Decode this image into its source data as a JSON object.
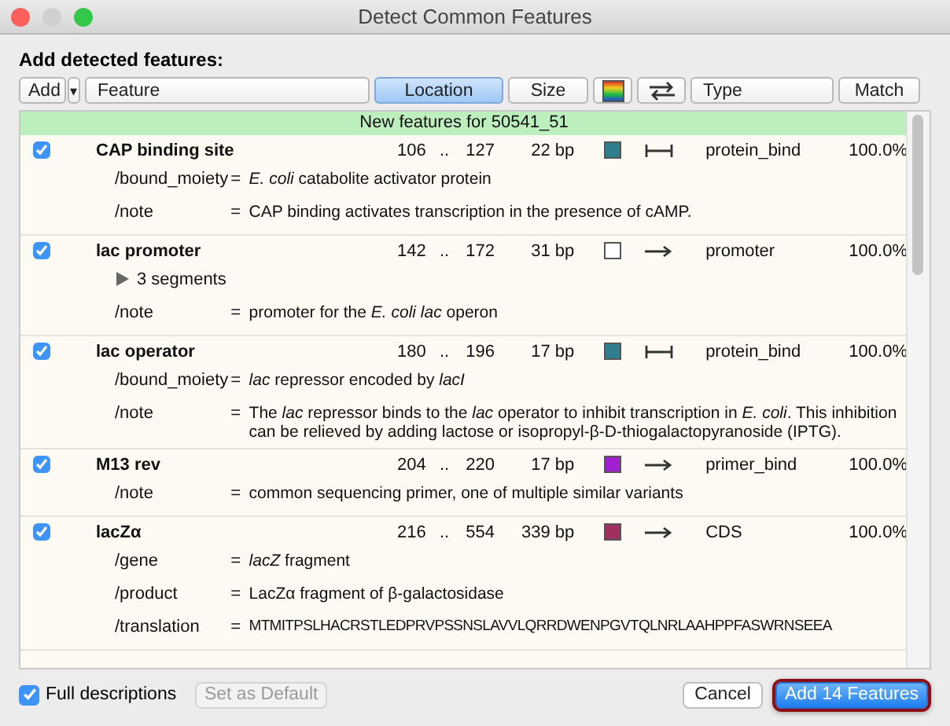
{
  "window": {
    "title": "Detect Common Features"
  },
  "heading": "Add detected features:",
  "columns": [
    {
      "kind": "add",
      "label": "Add",
      "selected": false
    },
    {
      "kind": "menu",
      "label": "▾",
      "selected": false
    },
    {
      "kind": "feature",
      "label": "Feature",
      "selected": false
    },
    {
      "kind": "location",
      "label": "Location",
      "selected": true
    },
    {
      "kind": "size",
      "label": "Size",
      "selected": false
    },
    {
      "kind": "color",
      "selected": false
    },
    {
      "kind": "strand",
      "selected": false
    },
    {
      "kind": "type",
      "label": "Type",
      "selected": false
    },
    {
      "kind": "match",
      "label": "Match",
      "selected": false
    }
  ],
  "group_title": "New features for 50541_51",
  "features": [
    {
      "checked": true,
      "name": "CAP binding site",
      "start": "106",
      "dots": "..",
      "end": "127",
      "size": "22 bp",
      "color": "#2f7f8f",
      "kind": "range",
      "type": "protein_bind",
      "match": "100.0%",
      "qualifiers": [
        {
          "key": "/bound_moiety",
          "eq": "=",
          "value": "*E. coli* catabolite activator protein"
        },
        {
          "key": "/note",
          "eq": "=",
          "value": "CAP binding activates transcription in the presence of cAMP."
        }
      ]
    },
    {
      "checked": true,
      "name": "lac promoter",
      "start": "142",
      "dots": "..",
      "end": "172",
      "size": "31 bp",
      "color": "#ffffff",
      "kind": "forward",
      "type": "promoter",
      "match": "100.0%",
      "segments": "3 segments",
      "qualifiers": [
        {
          "key": "/note",
          "eq": "=",
          "value": "promoter for the *E. coli lac* operon"
        }
      ]
    },
    {
      "checked": true,
      "name": "lac operator",
      "start": "180",
      "dots": "..",
      "end": "196",
      "size": "17 bp",
      "color": "#2f7f8f",
      "kind": "range",
      "type": "protein_bind",
      "match": "100.0%",
      "qualifiers": [
        {
          "key": "/bound_moiety",
          "eq": "=",
          "value": "*lac* repressor encoded by *lacI*"
        },
        {
          "key": "/note",
          "eq": "=",
          "value": "The *lac* repressor binds to the *lac* operator to inhibit transcription in *E. coli*. This inhibition can be relieved by adding lactose or isopropyl-β-D-thiogalactopyranoside (IPTG)."
        }
      ]
    },
    {
      "checked": true,
      "name": "M13 rev",
      "start": "204",
      "dots": "..",
      "end": "220",
      "size": "17 bp",
      "color": "#a020d0",
      "kind": "forward",
      "type": "primer_bind",
      "match": "100.0%",
      "qualifiers": [
        {
          "key": "/note",
          "eq": "=",
          "value": "common sequencing primer, one of multiple similar variants"
        }
      ]
    },
    {
      "checked": true,
      "name": "lacZα",
      "start": "216",
      "dots": "..",
      "end": "554",
      "size": "339 bp",
      "color": "#a03060",
      "kind": "forward",
      "type": "CDS",
      "match": "100.0%",
      "qualifiers": [
        {
          "key": "/gene",
          "eq": "=",
          "value": "*lacZ* fragment"
        },
        {
          "key": "/product",
          "eq": "=",
          "value": "LacZα fragment of β-galactosidase"
        },
        {
          "key": "/translation",
          "eq": "=",
          "value": "MTMITPSLHACRSTLEDPRVPSSNSLAVVLQRRDWENPGVTQLNRLAAHPPFASWRNSEEA"
        }
      ]
    }
  ],
  "full_descriptions": {
    "label": "Full descriptions",
    "checked": true
  },
  "buttons": [
    {
      "kind": "default",
      "label": "Set as Default",
      "disabled": true
    },
    {
      "kind": "cancel",
      "label": "Cancel",
      "disabled": false
    },
    {
      "kind": "primary",
      "label": "Add 14 Features",
      "disabled": false
    }
  ]
}
